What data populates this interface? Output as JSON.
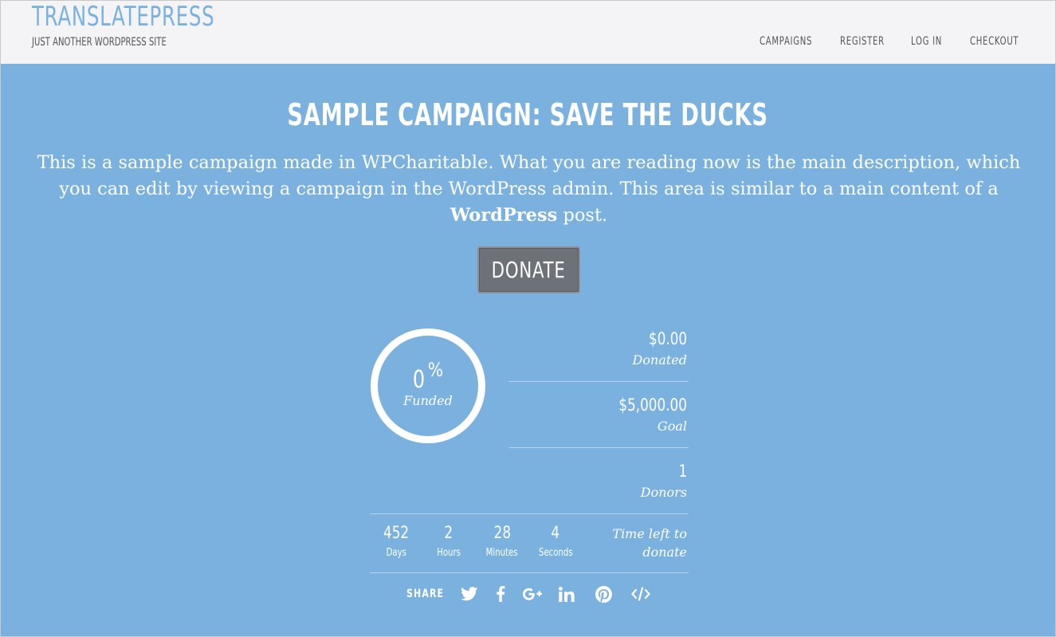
{
  "header": {
    "site_title": "TRANSLATEPRESS",
    "tagline": "JUST ANOTHER WORDPRESS SITE",
    "nav": [
      {
        "label": "CAMPAIGNS"
      },
      {
        "label": "REGISTER"
      },
      {
        "label": "LOG IN"
      },
      {
        "label": "CHECKOUT"
      }
    ]
  },
  "campaign": {
    "title": "SAMPLE CAMPAIGN: SAVE THE DUCKS",
    "description_part1": "This is a sample campaign made in WPCharitable. What you are reading now is the main description, which you can edit by viewing a campaign in the WordPress admin. This area is similar to a main content of a",
    "description_bold": "WordPress",
    "description_part2": "post.",
    "donate_label": "DONATE"
  },
  "stats": {
    "funded_percent": "0",
    "percent_sign": "%",
    "funded_label": "Funded",
    "donated_value": "$0.00",
    "donated_label": "Donated",
    "goal_value": "$5,000.00",
    "goal_label": "Goal",
    "donors_value": "1",
    "donors_label": "Donors"
  },
  "countdown": {
    "days": "452",
    "days_label": "Days",
    "hours": "2",
    "hours_label": "Hours",
    "minutes": "28",
    "minutes_label": "Minutes",
    "seconds": "4",
    "seconds_label": "Seconds",
    "time_left_label": "Time left to donate"
  },
  "share": {
    "label": "SHARE",
    "icons": [
      "twitter-icon",
      "facebook-icon",
      "google-plus-icon",
      "linkedin-icon",
      "pinterest-icon",
      "embed-code-icon"
    ]
  },
  "colors": {
    "background": "#7ab1df",
    "header_bg": "#f4f4f6",
    "site_title": "#7ab1df",
    "donate_button": "#6d7278"
  }
}
